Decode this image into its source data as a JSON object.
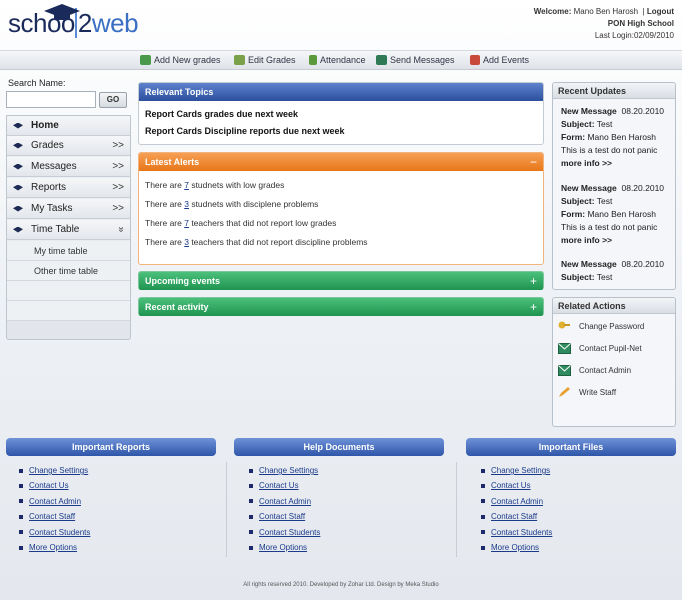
{
  "header": {
    "logo_part1": "schoo",
    "logo_part2": "2",
    "logo_part3": "web",
    "welcome_label": "Welcome:",
    "user_name": "Mano Ben Harosh",
    "separator": "|",
    "logout": "Logout",
    "school": "PON High School",
    "last_login": "Last Login:02/09/2010"
  },
  "toolbar": {
    "items": [
      "Add New grades",
      "Edit Grades",
      "Attendance",
      "Send Messages",
      "Add Events"
    ]
  },
  "search": {
    "label": "Search Name:",
    "value": "",
    "button": "GO"
  },
  "nav": {
    "items": [
      {
        "label": "Home",
        "arrow": ""
      },
      {
        "label": "Grades",
        "arrow": ">>"
      },
      {
        "label": "Messages",
        "arrow": ">>"
      },
      {
        "label": "Reports",
        "arrow": ">>"
      },
      {
        "label": "My Tasks",
        "arrow": ">>"
      },
      {
        "label": "Time Table",
        "arrow": "»"
      }
    ],
    "subitems": [
      "My time table",
      "Other time table"
    ]
  },
  "topics": {
    "title": "Relevant Topics",
    "items": [
      "Report Cards grades due next week",
      "Report Cards Discipline reports due next week"
    ]
  },
  "alerts": {
    "title": "Latest Alerts",
    "toggle": "−",
    "items": [
      {
        "pre": "There are ",
        "num": "7",
        "post": " studnets with low grades"
      },
      {
        "pre": "There are ",
        "num": "3",
        "post": " studnets with disciplene problems"
      },
      {
        "pre": "There are ",
        "num": "7",
        "post": " teachers that did not report low grades"
      },
      {
        "pre": "There are ",
        "num": "3",
        "post": " teachers that did not report discipline problems"
      }
    ]
  },
  "upcoming": {
    "title": "Upcoming events",
    "toggle": "+"
  },
  "activity": {
    "title": "Recent activity",
    "toggle": "+"
  },
  "updates": {
    "title": "Recent Updates",
    "items": [
      {
        "heading": "New Message",
        "date": "08.20.2010",
        "subject_label": "Subject:",
        "subject": "Test",
        "form_label": "Form:",
        "form": "Mano Ben Harosh",
        "body": "This is a test do not panic",
        "more": "more info >>"
      },
      {
        "heading": "New Message",
        "date": "08.20.2010",
        "subject_label": "Subject:",
        "subject": "Test",
        "form_label": "Form:",
        "form": "Mano Ben Harosh",
        "body": "This is a test do not panic",
        "more": "more info >>"
      },
      {
        "heading": "New Message",
        "date": "08.20.2010",
        "subject_label": "Subject:",
        "subject": "Test"
      }
    ]
  },
  "related": {
    "title": "Related Actions",
    "items": [
      {
        "label": "Change Password",
        "icon": "key-icon"
      },
      {
        "label": "Contact Pupil-Net",
        "icon": "mail-icon"
      },
      {
        "label": "Contact Admin",
        "icon": "mail-icon"
      },
      {
        "label": "Write Staff",
        "icon": "pencil-icon"
      }
    ]
  },
  "bottom": {
    "reports": {
      "title": "Important Reports",
      "links": [
        "Change Settings",
        "Contact Us",
        "Contact Admin",
        "Contact Staff",
        "Contact Students",
        "More Options"
      ]
    },
    "help": {
      "title": "Help Documents",
      "links": [
        "Change Settings",
        "Contact Us",
        "Contact Admin",
        "Contact Staff",
        "Contact Students",
        "More Options"
      ]
    },
    "files": {
      "title": "Important Files",
      "links": [
        "Change Settings",
        "Contact Us",
        "Contact Admin",
        "Contact Staff",
        "Contact Students",
        "More Options"
      ]
    }
  },
  "footer": "All rights reserved 2010. Developed by Zohar Ltd. Design by Meka Studio"
}
